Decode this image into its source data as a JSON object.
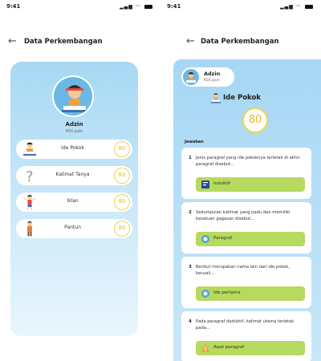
{
  "status": {
    "time": "9:41"
  },
  "left": {
    "title": "Data Perkembangan",
    "user": {
      "name": "Adzin",
      "points": "450 poin"
    },
    "items": [
      {
        "label": "Ide Pokok",
        "score": "80",
        "icon": "reading-kid-icon"
      },
      {
        "label": "Kalimat Tanya",
        "score": "80",
        "icon": "question-mark-icon"
      },
      {
        "label": "Iklan",
        "score": "80",
        "icon": "dancing-kid-icon"
      },
      {
        "label": "Pantun",
        "score": "80",
        "icon": "standing-kid-icon"
      }
    ]
  },
  "right": {
    "title": "Data Perkembangan",
    "user": {
      "name": "Adzin",
      "points": "450 poin"
    },
    "topic": "Ide Pokok",
    "score": "80",
    "answers_label": "Jawaban",
    "questions": [
      {
        "num": "1",
        "text": "Jenis paragraf yang ide pokoknya terletak di akhir paragraf disebut...",
        "answer": "Induktif"
      },
      {
        "num": "2",
        "text": "Sekumpulan kalimat yang padu dan memiliki kesatuan gagasan disebut...",
        "answer": "Paragraf"
      },
      {
        "num": "3",
        "text": "Berikut merupakan nama lain dari ide pokok, kecuali...",
        "answer": "Ide pertama"
      },
      {
        "num": "4",
        "text": "Pada paragraf deduktif, kalimat utama terletak pada...",
        "answer": "Awal paragraf"
      }
    ]
  },
  "colors": {
    "accent_score": "#f4d24a",
    "answer_bg": "#b6d95f",
    "panel_blue": "#a6d7f4"
  }
}
